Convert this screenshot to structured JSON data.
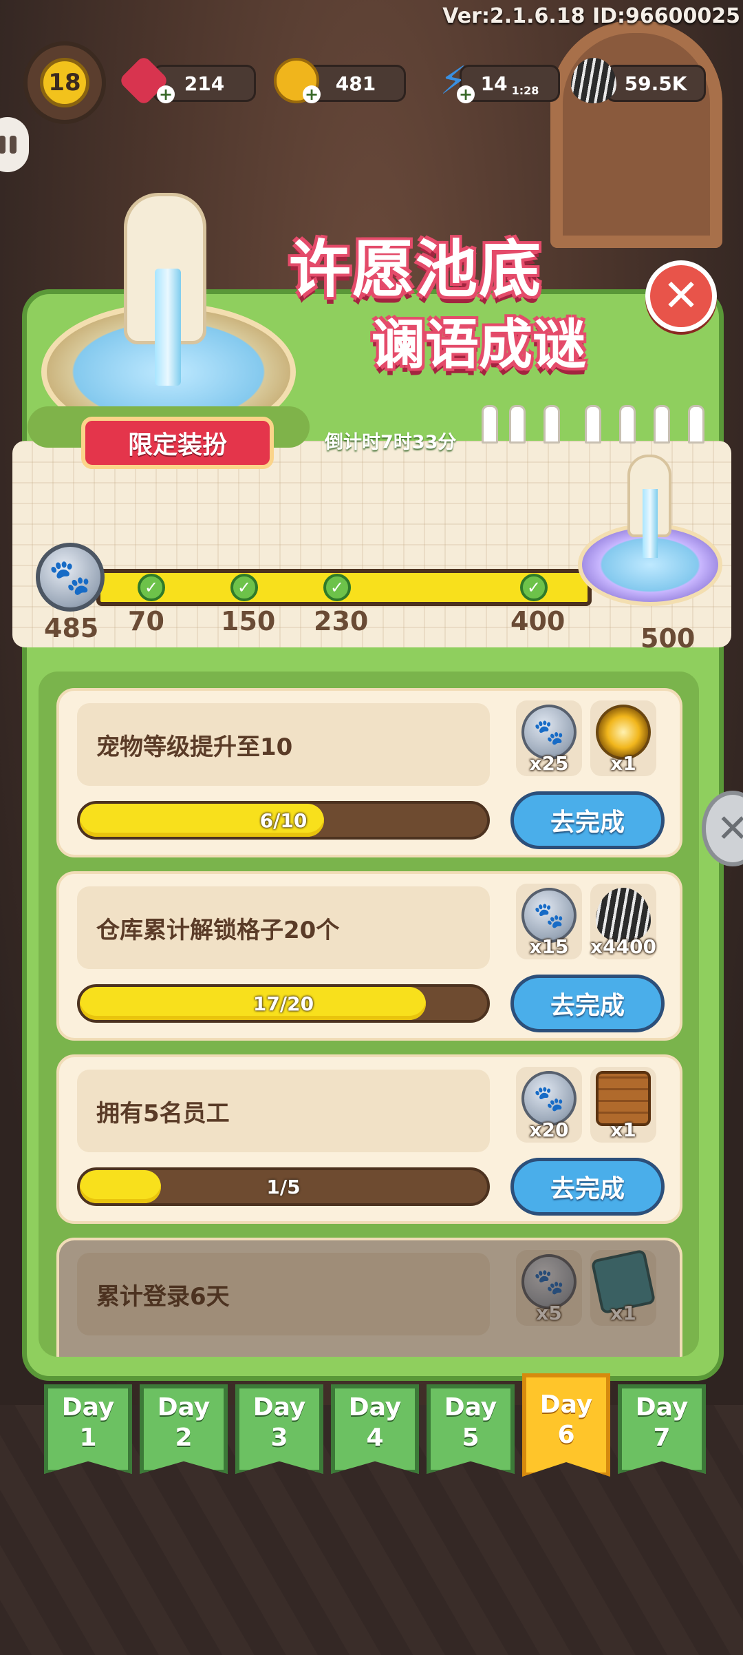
{
  "version_text": "Ver:2.1.6.18 ID:96600025",
  "hud": {
    "level": "18",
    "gems": "214",
    "coins": "481",
    "energy": "14",
    "energy_timer": "1:28",
    "seeds": "59.5K"
  },
  "event": {
    "title_line1": "许愿池底",
    "title_line2": "谰语成谜",
    "limited_tag": "限定装扮",
    "countdown": "倒计时7时33分",
    "current_points": "485"
  },
  "chart_data": {
    "type": "progress",
    "current": 485,
    "milestones": [
      {
        "value": 70,
        "label": "70",
        "claimed": true
      },
      {
        "value": 150,
        "label": "150",
        "claimed": true
      },
      {
        "value": 230,
        "label": "230",
        "claimed": true
      },
      {
        "value": 400,
        "label": "400",
        "claimed": true
      },
      {
        "value": 500,
        "label": "500",
        "claimed": false
      }
    ]
  },
  "tasks": [
    {
      "label": "宠物等级提升至10",
      "progress_text": "6/10",
      "progress": 0.6,
      "rewards": [
        {
          "icon": "paw-coin-icon",
          "count": "x25"
        },
        {
          "icon": "golden-compass-icon",
          "count": "x1"
        }
      ],
      "button": "去完成"
    },
    {
      "label": "仓库累计解锁格子20个",
      "progress_text": "17/20",
      "progress": 0.85,
      "rewards": [
        {
          "icon": "paw-coin-icon",
          "count": "x15"
        },
        {
          "icon": "sunflower-seed-icon",
          "count": "x4400"
        }
      ],
      "button": "去完成"
    },
    {
      "label": "拥有5名员工",
      "progress_text": "1/5",
      "progress": 0.2,
      "rewards": [
        {
          "icon": "paw-coin-icon",
          "count": "x20"
        },
        {
          "icon": "wooden-chest-icon",
          "count": "x1"
        }
      ],
      "button": "去完成"
    },
    {
      "label": "累计登录6天",
      "rewards": [
        {
          "icon": "paw-coin-icon",
          "count": "x5"
        },
        {
          "icon": "seed-ticket-icon",
          "count": "x1"
        }
      ]
    }
  ],
  "days": [
    {
      "word": "Day",
      "num": "1"
    },
    {
      "word": "Day",
      "num": "2"
    },
    {
      "word": "Day",
      "num": "3"
    },
    {
      "word": "Day",
      "num": "4"
    },
    {
      "word": "Day",
      "num": "5"
    },
    {
      "word": "Day",
      "num": "6",
      "active": true
    },
    {
      "word": "Day",
      "num": "7"
    }
  ],
  "colors": {
    "panel_green": "#8fcf5e",
    "button_blue": "#4aaeea",
    "bar_yellow": "#f8e01c",
    "active_tab": "#ffc52a"
  }
}
